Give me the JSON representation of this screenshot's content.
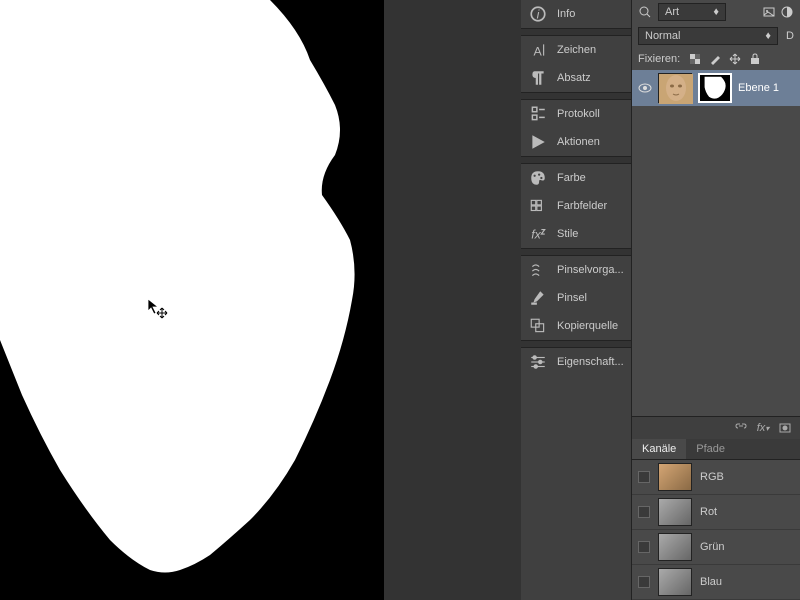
{
  "panels": {
    "info": "Info",
    "zeichen": "Zeichen",
    "absatz": "Absatz",
    "protokoll": "Protokoll",
    "aktionen": "Aktionen",
    "farbe": "Farbe",
    "farbfelder": "Farbfelder",
    "stile": "Stile",
    "pinselvorgaben": "Pinselvorga...",
    "pinsel": "Pinsel",
    "kopierquelle": "Kopierquelle",
    "eigenschaften": "Eigenschaft..."
  },
  "filter_dropdown": "Art",
  "blend_mode": "Normal",
  "opacity_label": "D",
  "lock_label": "Fixieren:",
  "layer": {
    "name": "Ebene 1"
  },
  "tabs": {
    "channels": "Kanäle",
    "paths": "Pfade"
  },
  "channels": {
    "rgb": "RGB",
    "red": "Rot",
    "green": "Grün",
    "blue": "Blau"
  }
}
